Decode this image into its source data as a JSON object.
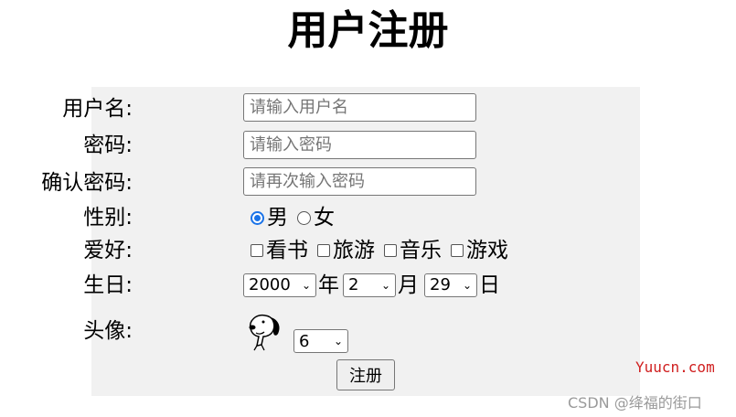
{
  "page_title": "用户注册",
  "form": {
    "username": {
      "label": "用户名:",
      "placeholder": "请输入用户名"
    },
    "password": {
      "label": "密码:",
      "placeholder": "请输入密码"
    },
    "confirm": {
      "label": "确认密码:",
      "placeholder": "请再次输入密码"
    },
    "gender": {
      "label": "性别:",
      "options": [
        "男",
        "女"
      ],
      "selected": "男"
    },
    "hobbies": {
      "label": "爱好:",
      "options": [
        "看书",
        "旅游",
        "音乐",
        "游戏"
      ]
    },
    "birthday": {
      "label": "生日:",
      "year": "2000",
      "year_unit": "年",
      "month": "2",
      "month_unit": "月",
      "day": "29",
      "day_unit": "日"
    },
    "avatar": {
      "label": "头像:",
      "selected": "6",
      "icon": "snoopy-avatar"
    },
    "submit_label": "注册"
  },
  "watermarks": {
    "site": "Yuucn.com",
    "author": "CSDN @绛福的街口"
  }
}
